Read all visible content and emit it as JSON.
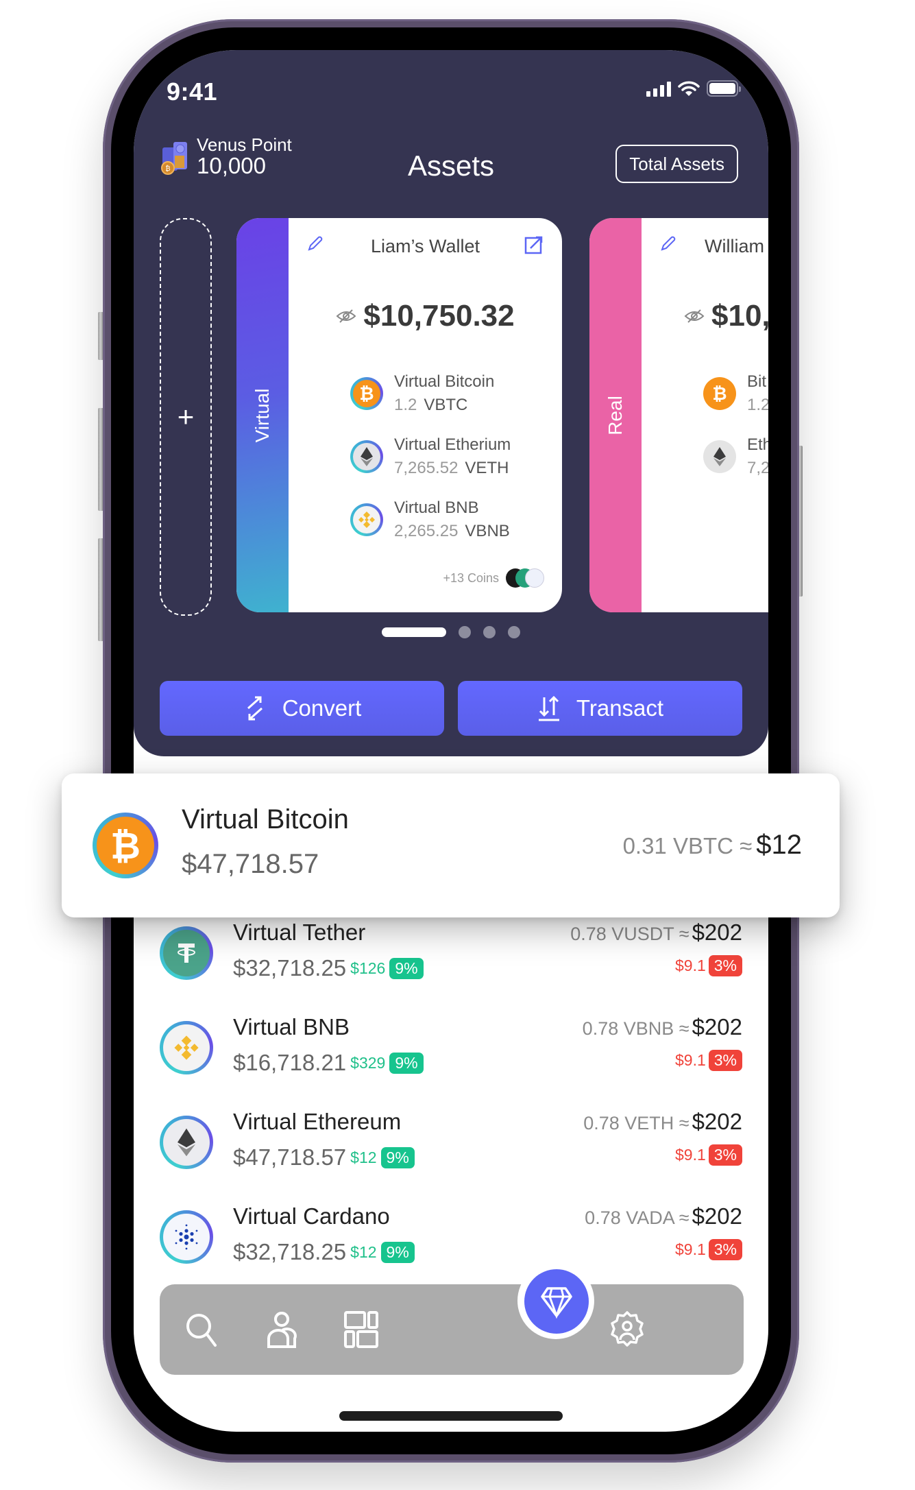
{
  "status_bar": {
    "time": "9:41",
    "icons": [
      "cellular-signal-icon",
      "wifi-icon",
      "battery-icon"
    ]
  },
  "header": {
    "points_label": "Venus Point",
    "points_value": "10,000",
    "points_icon": "coin-vault-icon",
    "title": "Assets",
    "total_assets_button": "Total Assets"
  },
  "carousel": {
    "add_wallet_icon": "plus-icon",
    "active_index": 0,
    "page_count": 4,
    "wallets": [
      {
        "type_label": "Virtual",
        "name": "Liam’s Wallet",
        "balance": "$10,750.32",
        "coins": [
          {
            "name": "Virtual Bitcoin",
            "amount": "1.2",
            "symbol": "VBTC",
            "icon": "bitcoin-icon"
          },
          {
            "name": "Virtual Etherium",
            "amount": "7,265.52",
            "symbol": "VETH",
            "icon": "ethereum-icon"
          },
          {
            "name": "Virtual BNB",
            "amount": "2,265.25",
            "symbol": "VBNB",
            "icon": "bnb-icon"
          }
        ],
        "more_coins": "+13 Coins"
      },
      {
        "type_label": "Real",
        "name": "William",
        "balance": "$10,",
        "coins": [
          {
            "name": "Bit",
            "amount": "1.2",
            "icon": "bitcoin-icon"
          },
          {
            "name": "Eth",
            "amount": "7,2",
            "icon": "ethereum-icon"
          }
        ]
      }
    ]
  },
  "actions": {
    "convert": "Convert",
    "transact": "Transact"
  },
  "featured": {
    "name": "Virtual Bitcoin",
    "price": "$47,718.57",
    "holding": "0.31 VBTC ≈",
    "value": "$12",
    "icon": "bitcoin-icon"
  },
  "assets": [
    {
      "name": "Virtual Tether",
      "price": "$32,718.25",
      "gain": "$126",
      "gain_pct": "9%",
      "holding": "0.78 VUSDT ≈",
      "value": "$202",
      "loss": "$9.1",
      "loss_pct": "3%",
      "icon": "tether-icon"
    },
    {
      "name": "Virtual BNB",
      "price": "$16,718.21",
      "gain": "$329",
      "gain_pct": "9%",
      "holding": "0.78 VBNB ≈",
      "value": "$202",
      "loss": "$9.1",
      "loss_pct": "3%",
      "icon": "bnb-icon"
    },
    {
      "name": "Virtual Ethereum",
      "price": "$47,718.57",
      "gain": "$12",
      "gain_pct": "9%",
      "holding": "0.78 VETH ≈",
      "value": "$202",
      "loss": "$9.1",
      "loss_pct": "3%",
      "icon": "ethereum-icon"
    },
    {
      "name": "Virtual Cardano",
      "price": "$32,718.25",
      "gain": "$12",
      "gain_pct": "9%",
      "holding": "0.78 VADA ≈",
      "value": "$202",
      "loss": "$9.1",
      "loss_pct": "3%",
      "icon": "cardano-icon"
    }
  ],
  "tab_bar": {
    "tabs": [
      "search-icon",
      "users-icon",
      "dashboard-icon",
      "diamond-icon",
      "user-settings-icon"
    ],
    "active": "diamond-icon"
  },
  "colors": {
    "header_bg": "#353451",
    "accent": "#5c66f5",
    "virtual_strip": "#6a42e6",
    "real_strip": "#ea63a6",
    "gain": "#17c48e",
    "loss": "#f0433a"
  }
}
